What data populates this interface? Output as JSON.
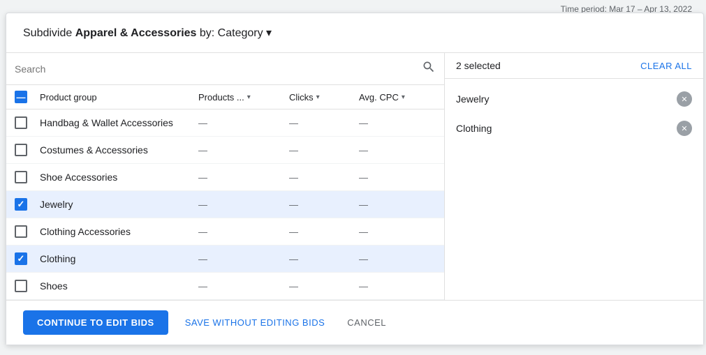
{
  "timePeriod": "Time period: Mar 17 – Apr 13, 2022",
  "header": {
    "prefix": "Subdivide ",
    "title": "Apparel & Accessories",
    "suffix": " by: Category",
    "dropdownIcon": "▾"
  },
  "search": {
    "placeholder": "Search"
  },
  "columns": {
    "productGroup": "Product group",
    "products": "Products ...",
    "clicks": "Clicks",
    "avgCpc": "Avg. CPC"
  },
  "rows": [
    {
      "id": 1,
      "label": "Handbag & Wallet Accessories",
      "products": "—",
      "clicks": "—",
      "cpc": "—",
      "checked": false,
      "selected": false
    },
    {
      "id": 2,
      "label": "Costumes & Accessories",
      "products": "—",
      "clicks": "—",
      "cpc": "—",
      "checked": false,
      "selected": false
    },
    {
      "id": 3,
      "label": "Shoe Accessories",
      "products": "—",
      "clicks": "—",
      "cpc": "—",
      "checked": false,
      "selected": false
    },
    {
      "id": 4,
      "label": "Jewelry",
      "products": "—",
      "clicks": "—",
      "cpc": "—",
      "checked": true,
      "selected": true
    },
    {
      "id": 5,
      "label": "Clothing Accessories",
      "products": "—",
      "clicks": "—",
      "cpc": "—",
      "checked": false,
      "selected": false
    },
    {
      "id": 6,
      "label": "Clothing",
      "products": "—",
      "clicks": "—",
      "cpc": "—",
      "checked": true,
      "selected": true
    },
    {
      "id": 7,
      "label": "Shoes",
      "products": "—",
      "clicks": "—",
      "cpc": "—",
      "checked": false,
      "selected": false
    }
  ],
  "rightPanel": {
    "selectedCount": "2 selected",
    "clearAll": "CLEAR ALL",
    "selectedItems": [
      {
        "label": "Jewelry"
      },
      {
        "label": "Clothing"
      }
    ]
  },
  "footer": {
    "continueBtn": "CONTINUE TO EDIT BIDS",
    "saveBtn": "SAVE WITHOUT EDITING BIDS",
    "cancelBtn": "CANCEL"
  }
}
